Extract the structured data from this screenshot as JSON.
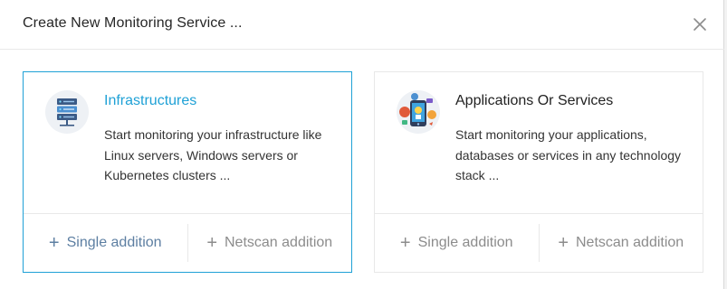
{
  "dialog": {
    "title": "Create New Monitoring Service ...",
    "close_icon": "close-icon"
  },
  "cards": [
    {
      "icon": "server-rack-icon",
      "title": "Infrastructures",
      "description": "Start monitoring your infrastructure like Linux servers, Windows servers or Kubernetes clusters ...",
      "single_label": "Single addition",
      "netscan_label": "Netscan addition",
      "selected": true
    },
    {
      "icon": "apps-services-icon",
      "title": "Applications Or Services",
      "description": "Start monitoring your applications, databases or services in any technology stack ...",
      "single_label": "Single addition",
      "netscan_label": "Netscan addition",
      "selected": false
    }
  ],
  "colors": {
    "accent": "#1fa1d6",
    "border": "#e8e8e8",
    "muted": "#8c8c8c"
  }
}
